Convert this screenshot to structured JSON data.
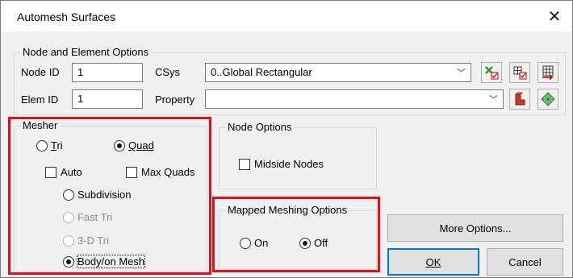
{
  "window": {
    "title": "Automesh Surfaces"
  },
  "node_element_options": {
    "legend": "Node and Element Options",
    "node_id_label": "Node ID",
    "node_id_value": "1",
    "elem_id_label": "Elem ID",
    "elem_id_value": "1",
    "csys_label": "CSys",
    "csys_value": "0..Global Rectangular",
    "property_label": "Property",
    "property_value": ""
  },
  "mesher": {
    "legend": "Mesher",
    "tri_label": "Tri",
    "quad_label": "Quad",
    "auto_label": "Auto",
    "max_quads_label": "Max Quads",
    "subdivision_label": "Subdivision",
    "fast_tri_label": "Fast Tri",
    "tri3d_label": "3-D Tri",
    "bodyon_label": "Body/on Mesh"
  },
  "node_options": {
    "legend": "Node Options",
    "midside_label": "Midside Nodes"
  },
  "mapped_meshing": {
    "legend": "Mapped Meshing Options",
    "on_label": "On",
    "off_label": "Off"
  },
  "buttons": {
    "more_options": "More Options...",
    "ok": "OK",
    "cancel": "Cancel"
  }
}
